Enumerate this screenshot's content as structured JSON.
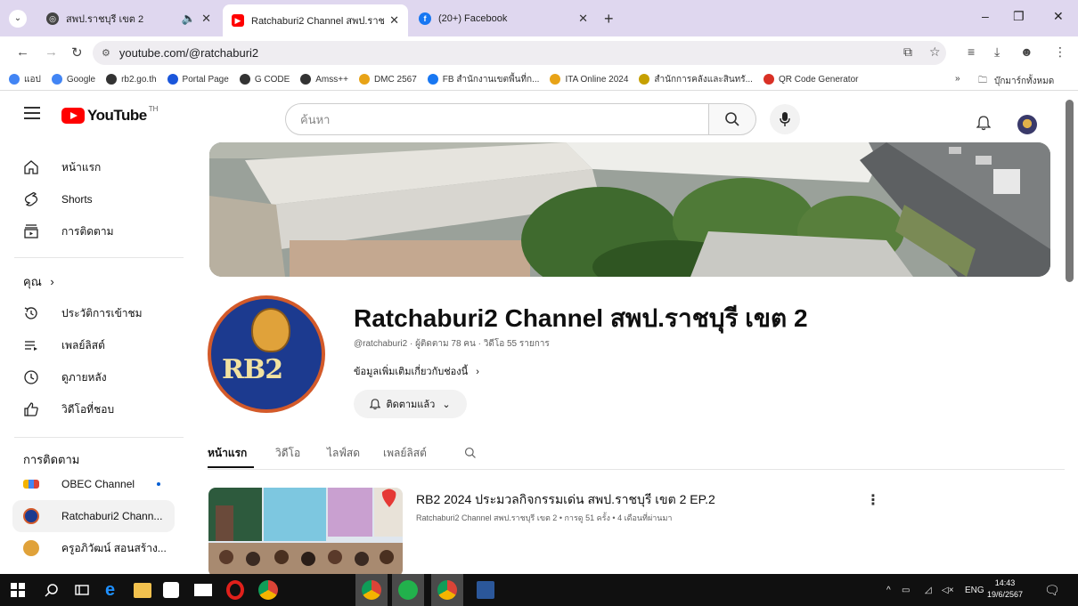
{
  "browser": {
    "tabs": [
      {
        "title": "สพป.ราชบุรี เขต 2",
        "active": false
      },
      {
        "title": "Ratchaburi2 Channel สพป.ราชบุรี",
        "active": true
      },
      {
        "title": "(20+) Facebook",
        "active": false
      }
    ],
    "new_tab_symbol": "+",
    "address": "youtube.com/@ratchaburi2",
    "window_controls": {
      "minimize": "–",
      "restore": "❐",
      "close": "✕"
    }
  },
  "bookmarks": [
    {
      "label": "แอป",
      "icon": "apps-grid-icon",
      "color": "#4285f4"
    },
    {
      "label": "Google",
      "icon": "google-icon",
      "color": "#4285f4"
    },
    {
      "label": "rb2.go.th",
      "icon": "globe-icon",
      "color": "#333333"
    },
    {
      "label": "Portal Page",
      "icon": "portal-icon",
      "color": "#1a56db"
    },
    {
      "label": "G CODE",
      "icon": "globe-icon",
      "color": "#333333"
    },
    {
      "label": "Amss++",
      "icon": "globe-icon",
      "color": "#333333"
    },
    {
      "label": "DMC 2567",
      "icon": "flask-icon",
      "color": "#e8a317"
    },
    {
      "label": "FB สำนักงานเขตพื้นที่ก...",
      "icon": "facebook-icon",
      "color": "#1877f2"
    },
    {
      "label": "ITA Online 2024",
      "icon": "flask-icon",
      "color": "#e8a317"
    },
    {
      "label": "สำนักการคลังและสินทรั...",
      "icon": "seal-icon",
      "color": "#c6a000"
    },
    {
      "label": "QR Code Generator",
      "icon": "qr-icon",
      "color": "#d93025"
    }
  ],
  "bookmarks_more": "»",
  "bookmarks_all": "บุ๊กมาร์กทั้งหมด",
  "youtube": {
    "logo_text": "YouTube",
    "country_code": "TH",
    "search_placeholder": "ค้นหา",
    "sidebar": {
      "main": [
        {
          "label": "หน้าแรก",
          "icon": "home-icon"
        },
        {
          "label": "Shorts",
          "icon": "shorts-icon"
        },
        {
          "label": "การติดตาม",
          "icon": "subscriptions-icon"
        }
      ],
      "you_header": "คุณ",
      "you": [
        {
          "label": "ประวัติการเข้าชม",
          "icon": "history-icon"
        },
        {
          "label": "เพลย์ลิสต์",
          "icon": "playlist-icon"
        },
        {
          "label": "ดูภายหลัง",
          "icon": "watch-later-icon"
        },
        {
          "label": "วิดีโอที่ชอบ",
          "icon": "like-icon"
        }
      ],
      "subs_header": "การติดตาม",
      "subs": [
        {
          "label": "OBEC Channel",
          "live": true
        },
        {
          "label": "Ratchaburi2 Chann...",
          "live": false,
          "active": true
        },
        {
          "label": "ครูอภิวัฒน์ สอนสร้าง...",
          "live": false
        }
      ]
    },
    "channel": {
      "name": "Ratchaburi2 Channel สพป.ราชบุรี เขต 2",
      "meta": "@ratchaburi2 · ผู้ติดตาม 78 คน · วิดีโอ 55 รายการ",
      "more_info": "ข้อมูลเพิ่มเติมเกี่ยวกับช่องนี้",
      "subscribed_label": "ติดตามแล้ว",
      "avatar_text": "RB2",
      "brand_colors": {
        "navy": "#1c3a8f",
        "orange": "#d35a2a",
        "gold": "#e0a23a"
      },
      "tabs": [
        "หน้าแรก",
        "วิดีโอ",
        "ไลฟ์สด",
        "เพลย์ลิสต์"
      ],
      "active_tab": 0
    },
    "featured": {
      "title": "RB2 2024 ประมวลกิจกรรมเด่น สพป.ราชบุรี เขต 2 EP.2",
      "meta": "Ratchaburi2 Channel สพป.ราชบุรี เขต 2 • การดู 51 ครั้ง • 4 เดือนที่ผ่านมา"
    }
  },
  "taskbar": {
    "lang": "ENG",
    "time": "14:43",
    "date": "19/6/2567"
  }
}
